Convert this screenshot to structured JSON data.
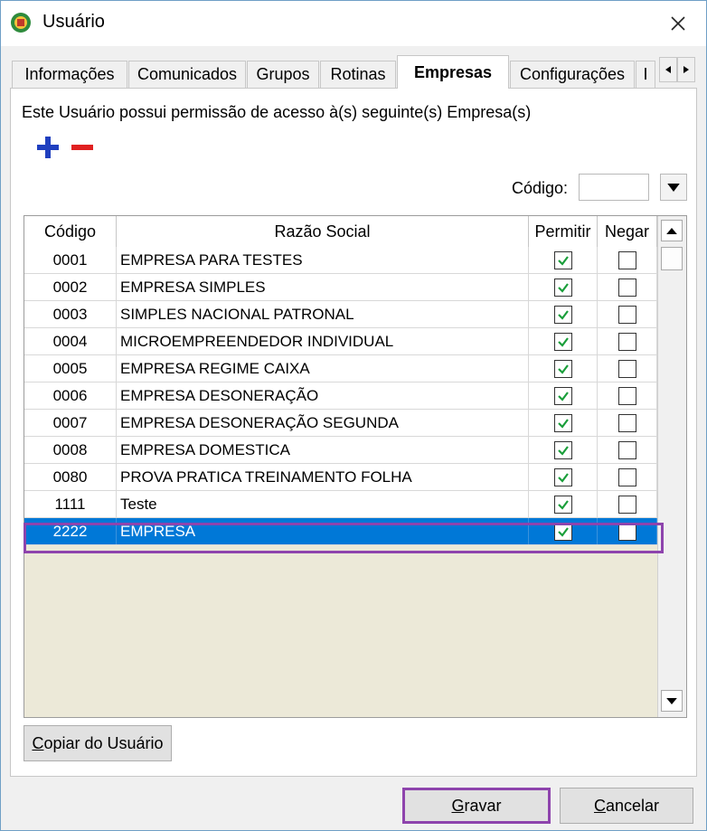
{
  "window": {
    "title": "Usuário"
  },
  "tabs": [
    {
      "label": "Informações"
    },
    {
      "label": "Comunicados"
    },
    {
      "label": "Grupos"
    },
    {
      "label": "Rotinas"
    },
    {
      "label": "Empresas"
    },
    {
      "label": "Configurações"
    },
    {
      "label": "I"
    }
  ],
  "active_tab": "Empresas",
  "panel": {
    "description": "Este Usuário possui permissão de acesso à(s) seguinte(s) Empresa(s)",
    "code_filter_label": "Código:",
    "code_filter_value": ""
  },
  "grid": {
    "headers": {
      "code": "Código",
      "name": "Razão Social",
      "permit": "Permitir",
      "deny": "Negar"
    },
    "rows": [
      {
        "code": "0001",
        "name": "EMPRESA PARA TESTES",
        "permit": true,
        "deny": false
      },
      {
        "code": "0002",
        "name": "EMPRESA SIMPLES",
        "permit": true,
        "deny": false
      },
      {
        "code": "0003",
        "name": "SIMPLES NACIONAL PATRONAL",
        "permit": true,
        "deny": false
      },
      {
        "code": "0004",
        "name": "MICROEMPREENDEDOR INDIVIDUAL",
        "permit": true,
        "deny": false
      },
      {
        "code": "0005",
        "name": "EMPRESA REGIME CAIXA",
        "permit": true,
        "deny": false
      },
      {
        "code": "0006",
        "name": "EMPRESA DESONERAÇÃO",
        "permit": true,
        "deny": false
      },
      {
        "code": "0007",
        "name": "EMPRESA DESONERAÇÃO SEGUNDA",
        "permit": true,
        "deny": false
      },
      {
        "code": "0008",
        "name": "EMPRESA DOMESTICA",
        "permit": true,
        "deny": false
      },
      {
        "code": "0080",
        "name": "PROVA PRATICA TREINAMENTO FOLHA",
        "permit": true,
        "deny": false
      },
      {
        "code": "1111",
        "name": "Teste",
        "permit": true,
        "deny": false
      },
      {
        "code": "2222",
        "name": "EMPRESA",
        "permit": true,
        "deny": false
      }
    ],
    "selected_code": "2222"
  },
  "buttons": {
    "copy": "Copiar do Usuário",
    "save": "Gravar",
    "cancel": "Cancelar"
  },
  "colors": {
    "selection": "#0078d7",
    "highlight": "#8e44ad",
    "add": "#1f3fbf",
    "remove": "#e02020",
    "check": "#1a9e3a"
  }
}
